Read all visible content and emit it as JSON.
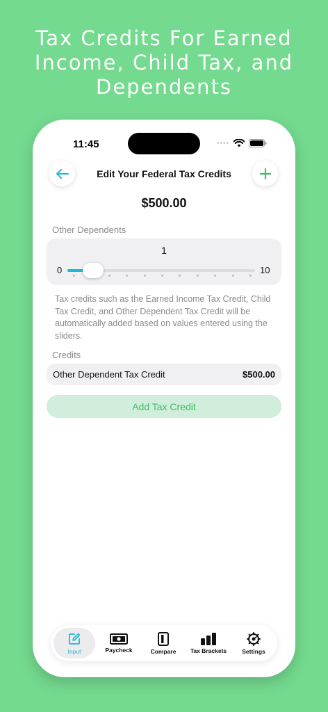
{
  "headline": [
    "Tax Credits For Earned",
    "Income, Child Tax, and",
    "Dependents"
  ],
  "status": {
    "time": "11:45"
  },
  "nav": {
    "title": "Edit Your Federal Tax Credits"
  },
  "total": "$500.00",
  "dependents": {
    "label": "Other Dependents",
    "value": "1",
    "min": "0",
    "max": "10",
    "level": 0.1
  },
  "note": "Tax credits such as the Earned Income Tax Credit, Child Tax Credit, and Other Dependent Tax Credit will be automatically added based on values entered using the sliders.",
  "credits": {
    "label": "Credits",
    "items": [
      {
        "name": "Other Dependent Tax Credit",
        "amount": "$500.00"
      }
    ],
    "add_label": "Add Tax Credit"
  },
  "tabs": [
    {
      "label": "Input",
      "icon": "edit-icon",
      "active": true
    },
    {
      "label": "Paycheck",
      "icon": "banknote-icon",
      "active": false
    },
    {
      "label": "Compare",
      "icon": "compare-icon",
      "active": false
    },
    {
      "label": "Tax Brackets",
      "icon": "bar-chart-icon",
      "active": false
    },
    {
      "label": "Settings",
      "icon": "gear-icon",
      "active": false
    }
  ],
  "colors": {
    "background": "#74da8f",
    "accent": "#1ab9d6",
    "green": "#3dbd6a"
  }
}
